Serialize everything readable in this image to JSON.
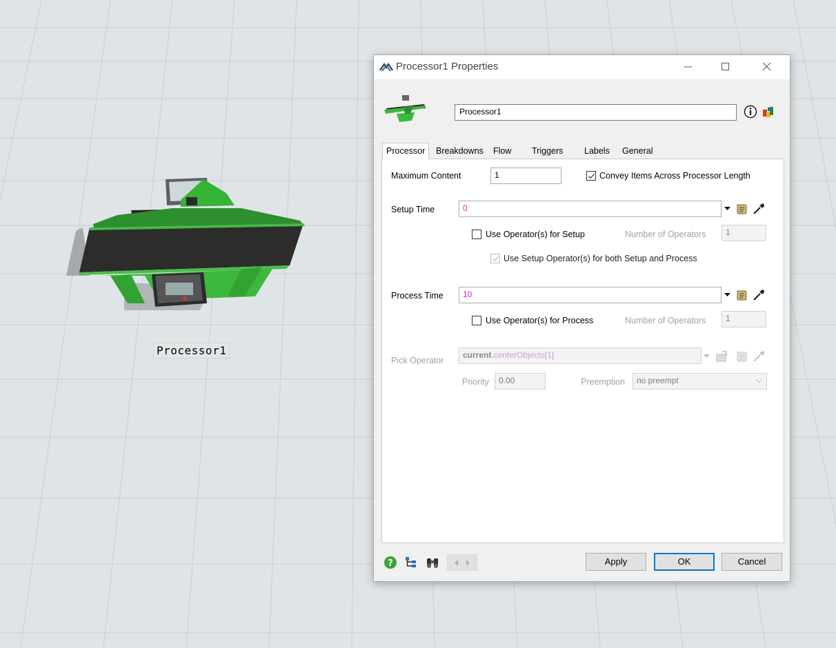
{
  "canvas": {
    "object_label": "Processor1"
  },
  "dialog": {
    "title": "Processor1  Properties",
    "object_name": "Processor1",
    "tabs": [
      "Processor",
      "Breakdowns",
      "Flow",
      "Triggers",
      "Labels",
      "General"
    ],
    "active_tab": "Processor",
    "processor": {
      "max_content_label": "Maximum Content",
      "max_content_value": "1",
      "convey_label": "Convey Items Across Processor Length",
      "convey_checked": true,
      "setup_time_label": "Setup Time",
      "setup_time_value": "0",
      "use_op_setup_label": "Use Operator(s) for Setup",
      "use_op_setup_checked": false,
      "num_ops_label_1": "Number of Operators",
      "num_ops_value_1": "1",
      "use_setup_both_label": "Use Setup Operator(s) for both Setup and Process",
      "use_setup_both_checked": true,
      "process_time_label": "Process Time",
      "process_time_value": "10",
      "use_op_process_label": "Use Operator(s) for Process",
      "use_op_process_checked": false,
      "num_ops_label_2": "Number of Operators",
      "num_ops_value_2": "1",
      "pick_operator_label": "Pick Operator",
      "pick_operator_keyword": "current",
      "pick_operator_dot": ".",
      "pick_operator_member": "centerObjects",
      "pick_operator_index": "[1]",
      "priority_label": "Priority",
      "priority_value": "0.00",
      "preemption_label": "Preemption",
      "preemption_value": "no preempt"
    },
    "buttons": {
      "apply": "Apply",
      "ok": "OK",
      "cancel": "Cancel"
    },
    "icons": [
      "help-icon",
      "tree-icon",
      "binoculars-icon",
      "prev-arrow-icon",
      "next-arrow-icon",
      "dropdown-arrow-icon",
      "code-scroll-icon",
      "eyedropper-icon",
      "info-icon",
      "colors-icon"
    ],
    "colors": {
      "accent": "#0078d7",
      "code_highlight": "#d41fd4",
      "model_green": "#3cb83c"
    }
  }
}
